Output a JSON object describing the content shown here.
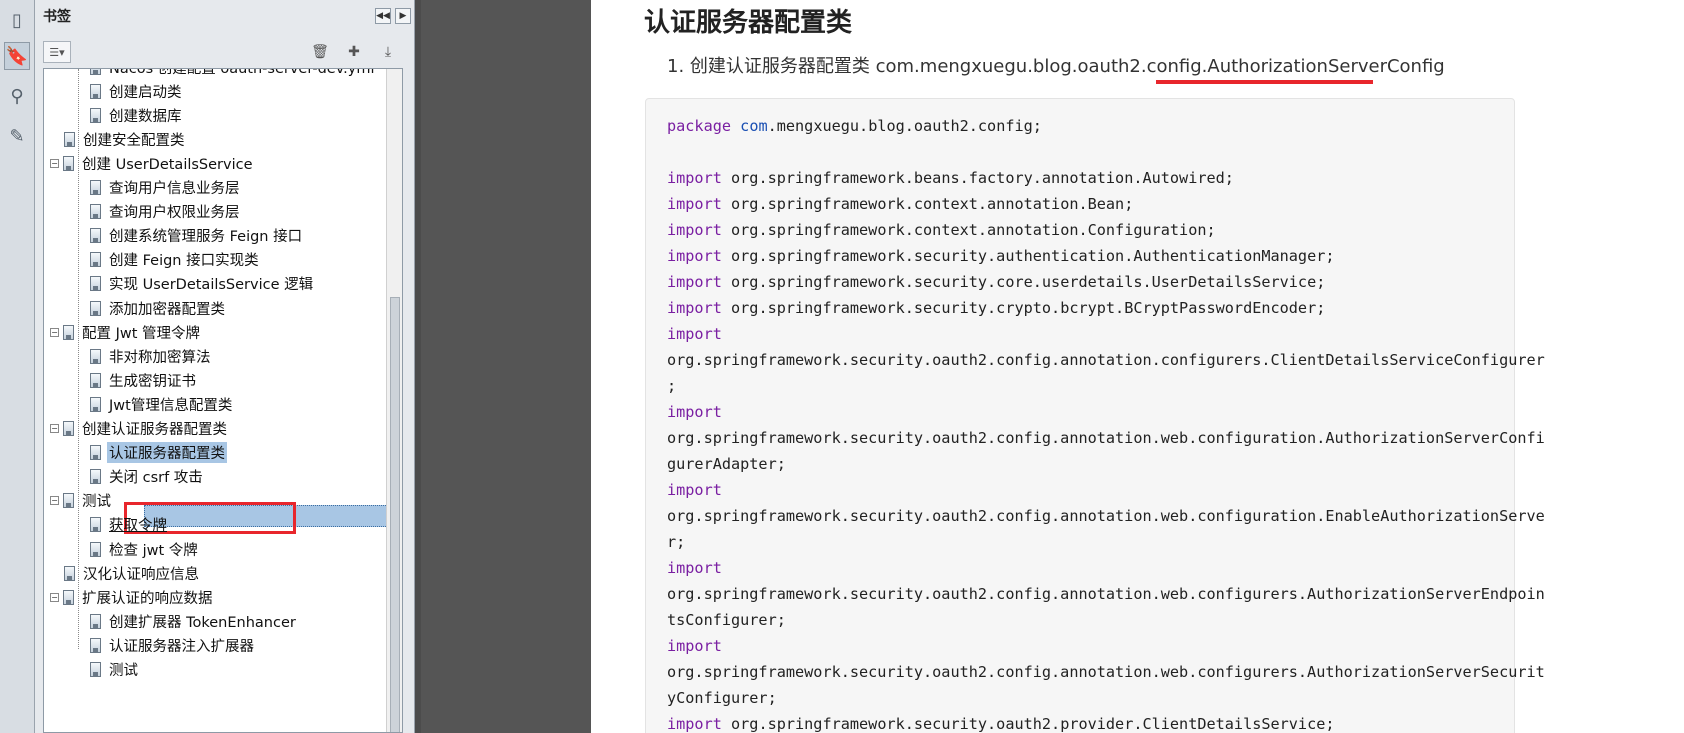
{
  "bookmarks_panel": {
    "title": "书签",
    "items": [
      {
        "label": "Nacos 创建配置 oauth-server-dev.yml",
        "level": 2
      },
      {
        "label": "创建启动类",
        "level": 2
      },
      {
        "label": "创建数据库",
        "level": 2
      },
      {
        "label": "创建安全配置类",
        "level": 1
      },
      {
        "label": "创建 UserDetailsService",
        "level": 1,
        "toggle": "−"
      },
      {
        "label": "查询用户信息业务层",
        "level": 2
      },
      {
        "label": "查询用户权限业务层",
        "level": 2
      },
      {
        "label": "创建系统管理服务 Feign 接口",
        "level": 2
      },
      {
        "label": "创建 Feign 接口实现类",
        "level": 2
      },
      {
        "label": "实现 UserDetailsService 逻辑",
        "level": 2
      },
      {
        "label": "添加加密器配置类",
        "level": 2
      },
      {
        "label": "配置 Jwt 管理令牌",
        "level": 1,
        "toggle": "−"
      },
      {
        "label": "非对称加密算法",
        "level": 2
      },
      {
        "label": "生成密钥证书",
        "level": 2
      },
      {
        "label": "Jwt管理信息配置类",
        "level": 2
      },
      {
        "label": "创建认证服务器配置类",
        "level": 1,
        "toggle": "−"
      },
      {
        "label": "认证服务器配置类",
        "level": 2,
        "selected": true
      },
      {
        "label": "关闭 csrf 攻击",
        "level": 2
      },
      {
        "label": "测试",
        "level": 1,
        "toggle": "−"
      },
      {
        "label": "获取令牌",
        "level": 2,
        "underline": true
      },
      {
        "label": "检查 jwt 令牌",
        "level": 2
      },
      {
        "label": "汉化认证响应信息",
        "level": 1
      },
      {
        "label": "扩展认证的响应数据",
        "level": 1,
        "toggle": "−"
      },
      {
        "label": "创建扩展器 TokenEnhancer",
        "level": 2
      },
      {
        "label": "认证服务器注入扩展器",
        "level": 2
      },
      {
        "label": "测试",
        "level": 2
      }
    ]
  },
  "document": {
    "heading": "认证服务器配置类",
    "list_item_text": "1. 创建认证服务器配置类 com.mengxuegu.blog.oauth2.config.AuthorizationServerConfig",
    "code_lines": [
      [
        {
          "t": "package",
          "c": "kw"
        },
        {
          "t": " "
        },
        {
          "t": "com",
          "c": "pk"
        },
        {
          "t": ".mengxuegu.blog.oauth2.config;"
        }
      ],
      [],
      [
        {
          "t": "import",
          "c": "kw"
        },
        {
          "t": " org.springframework.beans.factory.annotation.Autowired;"
        }
      ],
      [
        {
          "t": "import",
          "c": "kw"
        },
        {
          "t": " org.springframework.context.annotation.Bean;"
        }
      ],
      [
        {
          "t": "import",
          "c": "kw"
        },
        {
          "t": " org.springframework.context.annotation.Configuration;"
        }
      ],
      [
        {
          "t": "import",
          "c": "kw"
        },
        {
          "t": " org.springframework.security.authentication.AuthenticationManager;"
        }
      ],
      [
        {
          "t": "import",
          "c": "kw"
        },
        {
          "t": " org.springframework.security.core.userdetails.UserDetailsService;"
        }
      ],
      [
        {
          "t": "import",
          "c": "kw"
        },
        {
          "t": " org.springframework.security.crypto.bcrypt.BCryptPasswordEncoder;"
        }
      ],
      [
        {
          "t": "import",
          "c": "kw"
        }
      ],
      [
        {
          "t": "org.springframework.security.oauth2.config.annotation.configurers.ClientDetailsServiceConfigurer"
        }
      ],
      [
        {
          "t": ";"
        }
      ],
      [
        {
          "t": "import",
          "c": "kw"
        }
      ],
      [
        {
          "t": "org.springframework.security.oauth2.config.annotation.web.configuration.AuthorizationServerConfi"
        }
      ],
      [
        {
          "t": "gurerAdapter;"
        }
      ],
      [
        {
          "t": "import",
          "c": "kw"
        }
      ],
      [
        {
          "t": "org.springframework.security.oauth2.config.annotation.web.configuration.EnableAuthorizationServe"
        }
      ],
      [
        {
          "t": "r;"
        }
      ],
      [
        {
          "t": "import",
          "c": "kw"
        }
      ],
      [
        {
          "t": "org.springframework.security.oauth2.config.annotation.web.configurers.AuthorizationServerEndpoin"
        }
      ],
      [
        {
          "t": "tsConfigurer;"
        }
      ],
      [
        {
          "t": "import",
          "c": "kw"
        }
      ],
      [
        {
          "t": "org.springframework.security.oauth2.config.annotation.web.configurers.AuthorizationServerSecurit"
        }
      ],
      [
        {
          "t": "yConfigurer;"
        }
      ],
      [
        {
          "t": "import",
          "c": "kw"
        },
        {
          "t": " org.springframework.security.oauth2.provider.ClientDetailsService;"
        }
      ]
    ]
  },
  "colors": {
    "highlight_red": "#e8262c",
    "selection_blue": "#a8c6e4",
    "keyword_purple": "#7a1fa2"
  }
}
